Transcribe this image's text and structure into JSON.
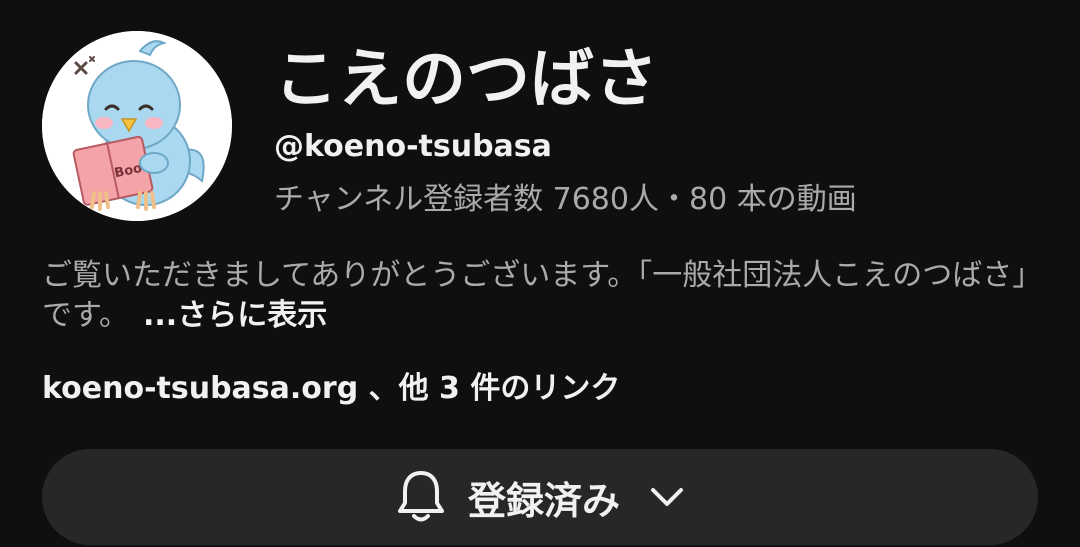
{
  "channel": {
    "name": "こえのつばさ",
    "handle": "@koeno-tsubasa",
    "stats": "チャンネル登録者数 7680人・80 本の動画"
  },
  "description": {
    "text": "ご覧いただきましてありがとうございます。「一般社団法人こえのつばさ」です。",
    "more_label": "...さらに表示"
  },
  "links": {
    "text": "koeno-tsubasa.org 、他 3 件のリンク"
  },
  "subscribe_button": {
    "label": "登録済み",
    "icon": "bell-icon",
    "dropdown_icon": "chevron-down-icon"
  },
  "avatar": {
    "icon": "bird-reading-book",
    "book_text": "Book"
  },
  "colors": {
    "background": "#0f0f0f",
    "primary_text": "#f1f1f1",
    "secondary_text": "#aaaaaa",
    "button_bg": "#272727",
    "avatar_bird": "#a9d8f0",
    "avatar_book": "#f4a3a8"
  }
}
